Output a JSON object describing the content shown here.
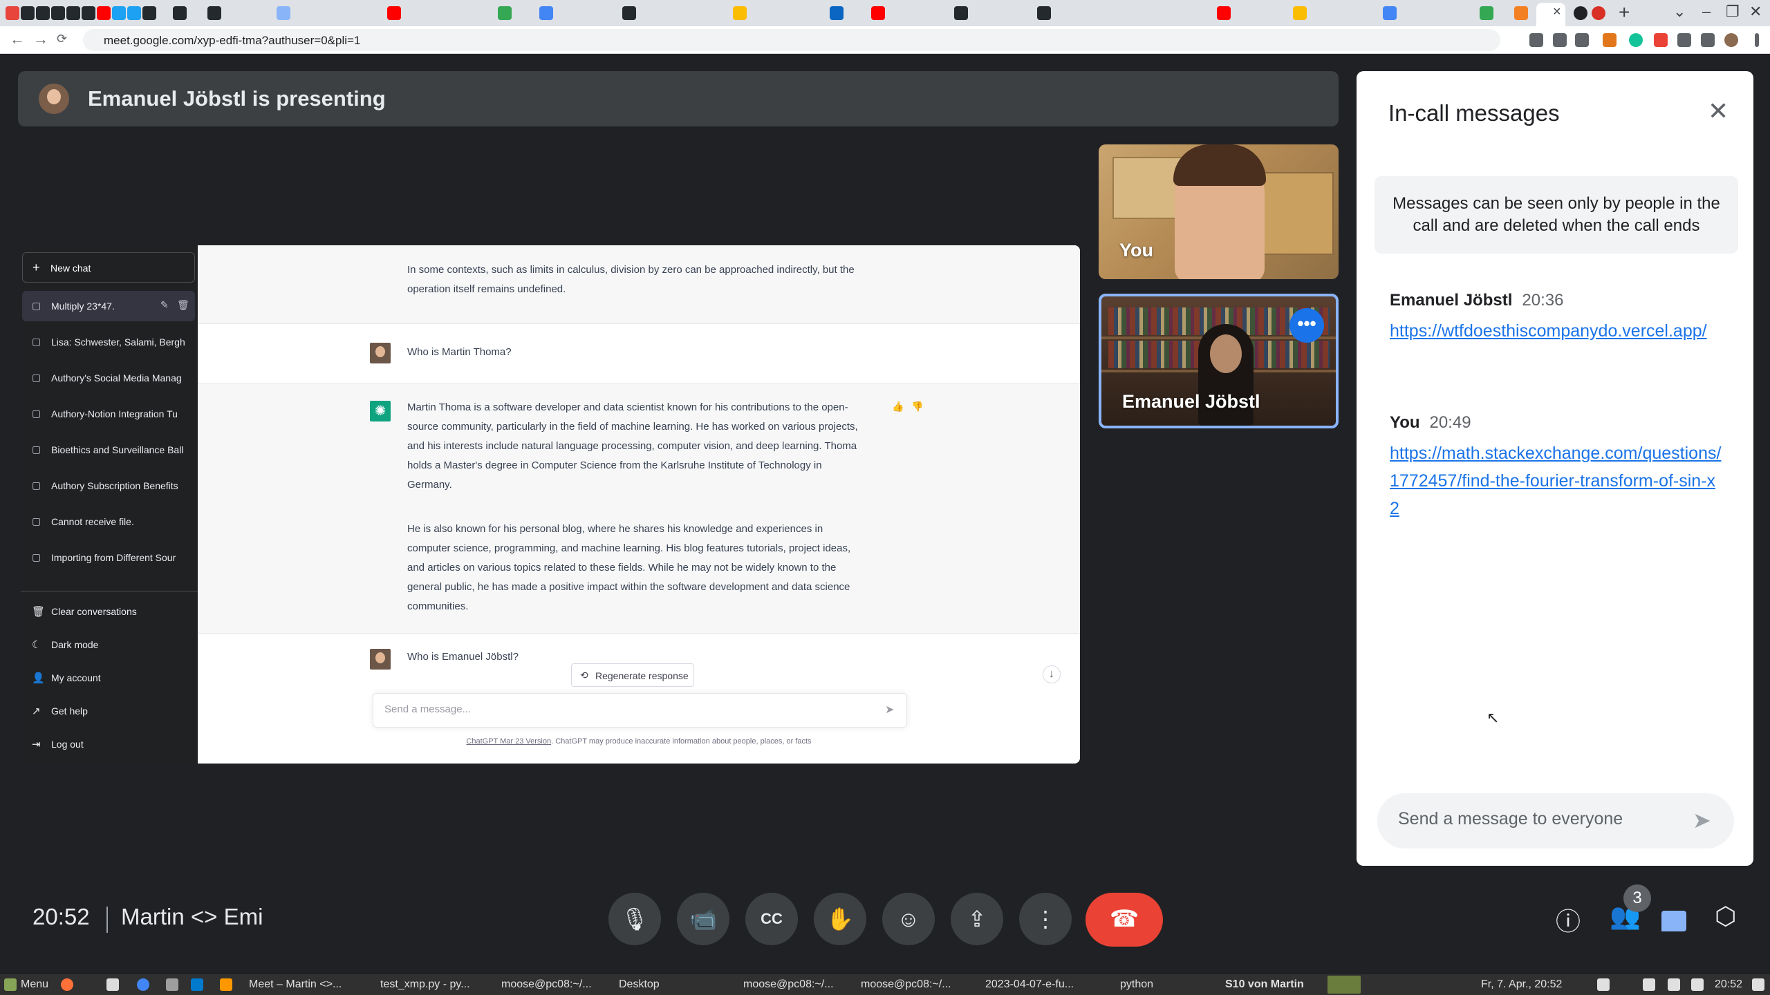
{
  "browser": {
    "url": "meet.google.com/xyp-edfi-tma?authuser=0&pli=1",
    "tab_close": "×",
    "new_tab": "+",
    "win_controls": [
      "⌄",
      "–",
      "❐",
      "✕"
    ]
  },
  "meet": {
    "presenting_banner": "Emanuel Jöbstl is presenting",
    "tiles": {
      "you_label": "You",
      "other_label": "Emanuel Jöbstl",
      "more_label": "•••"
    },
    "clock": "20:52",
    "meeting_title": "Martin <> Emi",
    "people_count": "3"
  },
  "chatgpt": {
    "sidebar": {
      "new_chat": "New chat",
      "items": [
        "Multiply 23*47.",
        "Lisa: Schwester, Salami, Bergh",
        "Authory's Social Media Manag",
        "Authory-Notion Integration Tu",
        "Bioethics and Surveillance Ball",
        "Authory Subscription Benefits",
        "Cannot receive file.",
        "Importing from Different Sour"
      ],
      "bottom": [
        "Clear conversations",
        "Dark mode",
        "My account",
        "Get help",
        "Log out"
      ]
    },
    "messages": {
      "partial_answer": "In some contexts, such as limits in calculus, division by zero can be approached indirectly, but the operation itself remains undefined.",
      "q1": "Who is Martin Thoma?",
      "a1_p1": "Martin Thoma is a software developer and data scientist known for his contributions to the open-source community, particularly in the field of machine learning. He has worked on various projects, and his interests include natural language processing, computer vision, and deep learning. Thoma holds a Master's degree in Computer Science from the Karlsruhe Institute of Technology in Germany.",
      "a1_p2": "He is also known for his personal blog, where he shares his knowledge and experiences in computer science, programming, and machine learning. His blog features tutorials, project ideas, and articles on various topics related to these fields. While he may not be widely known to the general public, he has made a positive impact within the software development and data science communities.",
      "q2": "Who is Emanuel Jöbstl?"
    },
    "regenerate": "Regenerate response",
    "input_placeholder": "Send a message...",
    "footer_link": "ChatGPT Mar 23 Version",
    "footer_text": ". ChatGPT may produce inaccurate information about people, places, or facts"
  },
  "chat_panel": {
    "title": "In-call messages",
    "notice": "Messages can be seen only by people in the call and are deleted when the call ends",
    "messages": [
      {
        "sender": "Emanuel Jöbstl",
        "time": "20:36",
        "link": "https://wtfdoesthiscompanydo.vercel.app/"
      },
      {
        "sender": "You",
        "time": "20:49",
        "link": "https://math.stackexchange.com/questions/1772457/find-the-fourier-transform-of-sin-x2"
      }
    ],
    "input_placeholder": "Send a message to everyone"
  },
  "taskbar": {
    "menu": "Menu",
    "apps": [
      "Meet – Martin <>...",
      "test_xmp.py - py...",
      "moose@pc08:~/...",
      "Desktop",
      "moose@pc08:~/...",
      "moose@pc08:~/...",
      "2023-04-07-e-fu...",
      "python",
      "S10 von Martin"
    ],
    "datetime_left": "Fr, 7. Apr., 20:52",
    "clock": "20:52"
  },
  "icons": {
    "mic": "mic-icon",
    "camera": "camera-icon",
    "captions": "captions-icon",
    "hand": "raise-hand-icon",
    "emoji": "emoji-icon",
    "present": "present-icon",
    "more": "more-vert-icon",
    "leave": "call-end-icon",
    "info": "info-icon",
    "people": "people-icon",
    "chat": "chat-icon",
    "activities": "activities-icon"
  },
  "colors": {
    "meet_bg": "#202124",
    "leave": "#ea4335",
    "link": "#1a73e8",
    "active_tile_border": "#8ab4f8",
    "chatgpt_sidebar": "#202123"
  }
}
